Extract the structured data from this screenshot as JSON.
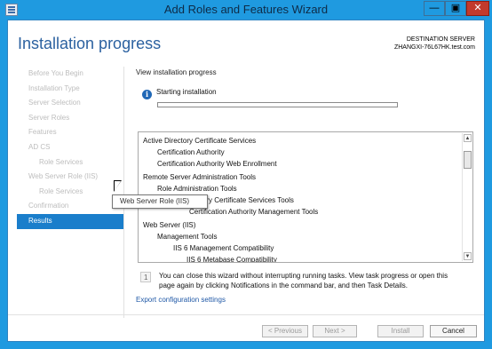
{
  "window": {
    "title": "Add Roles and Features Wizard"
  },
  "header": {
    "title": "Installation progress",
    "destination_label": "DESTINATION SERVER",
    "destination_server": "ZHANGXI-76L67HK.test.com"
  },
  "nav": {
    "items": [
      {
        "label": "Before You Begin"
      },
      {
        "label": "Installation Type"
      },
      {
        "label": "Server Selection"
      },
      {
        "label": "Server Roles"
      },
      {
        "label": "Features"
      },
      {
        "label": "AD CS"
      },
      {
        "label": "Role Services"
      },
      {
        "label": "Web Server Role (IIS)"
      },
      {
        "label": "Role Services"
      },
      {
        "label": "Confirmation"
      },
      {
        "label": "Results"
      }
    ]
  },
  "content": {
    "view_label": "View installation progress",
    "status": "Starting installation",
    "progress_fraction": 0.0,
    "features": [
      "Active Directory Certificate Services",
      "Certification Authority",
      "Certification Authority Web Enrollment",
      "Remote Server Administration Tools",
      "Role Administration Tools",
      "Directory Certificate Services Tools",
      "Certification Authority Management Tools",
      "Web Server (IIS)",
      "Management Tools",
      "IIS 6 Management Compatibility",
      "IIS 6 Metabase Compatibility"
    ],
    "tooltip": "Web Server Role (IIS)",
    "notice": "You can close this wizard without interrupting running tasks. View task progress or open this page again by clicking Notifications in the command bar, and then Task Details.",
    "export_link": "Export configuration settings"
  },
  "buttons": {
    "previous": "< Previous",
    "next": "Next >",
    "install": "Install",
    "cancel": "Cancel"
  },
  "colors": {
    "accent": "#1a7ecb",
    "titlebar": "#1f9ae0",
    "close": "#c23a2c"
  }
}
